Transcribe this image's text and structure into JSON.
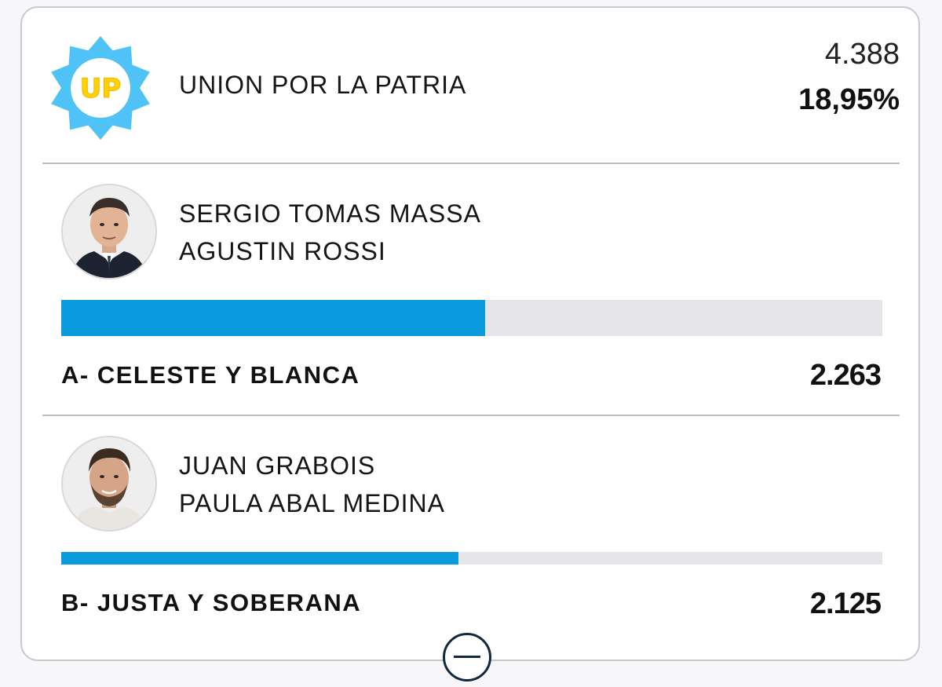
{
  "party": {
    "name": "UNION POR LA PATRIA",
    "logo_text": "UP",
    "logo_icon": "sun-badge-icon",
    "votes": "4.388",
    "percent": "18,95%"
  },
  "colors": {
    "accent": "#0a9ade",
    "track": "#e6e6e8",
    "logo_blue": "#4fc3f7",
    "logo_yellow": "#ffd200",
    "button_border": "#13283f"
  },
  "lists": [
    {
      "candidates": [
        "SERGIO TOMAS MASSA",
        "AGUSTIN ROSSI"
      ],
      "label": "A- CELESTE Y BLANCA",
      "votes": "2.263",
      "share_fraction": 0.516
    },
    {
      "candidates": [
        "JUAN GRABOIS",
        "PAULA ABAL MEDINA"
      ],
      "label": "B- JUSTA Y SOBERANA",
      "votes": "2.125",
      "share_fraction": 0.484
    }
  ],
  "controls": {
    "collapse_icon": "minus-circle-icon"
  }
}
